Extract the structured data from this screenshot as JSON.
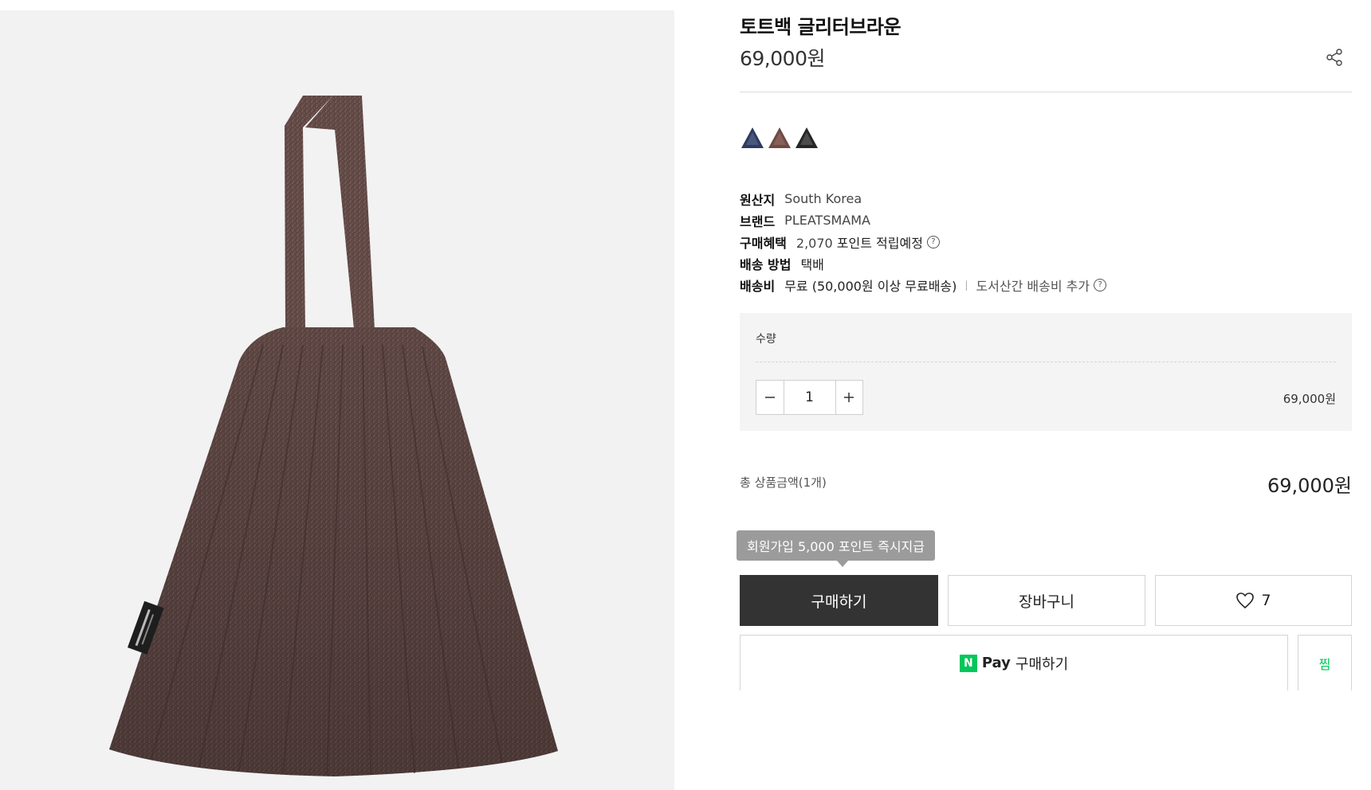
{
  "product": {
    "title": "토트백 글리터브라운",
    "price": "69,000원",
    "image_alt": "PLEATSMAMA"
  },
  "swatches": [
    {
      "name": "글리터블루",
      "color": "#2e3a5c"
    },
    {
      "name": "글리터브라운",
      "color": "#6e4a44"
    },
    {
      "name": "글리터블랙",
      "color": "#2a2a2a"
    }
  ],
  "specs": {
    "origin": {
      "key": "원산지",
      "value": "South Korea"
    },
    "brand": {
      "key": "브랜드",
      "value": "PLEATSMAMA"
    },
    "benefit": {
      "key": "구매혜택",
      "value_num": "2,070",
      "value_text": "포인트 적립예정"
    },
    "delivery_method": {
      "key": "배송 방법",
      "value": "택배"
    },
    "shipping_fee": {
      "key": "배송비",
      "value": "무료 (50,000원 이상 무료배송)",
      "extra": "도서산간 배송비 추가"
    }
  },
  "quantity": {
    "label": "수량",
    "value": "1",
    "line_price": "69,000원"
  },
  "total": {
    "label": "총 상품금액(1개)",
    "price": "69,000원"
  },
  "tooltip": "회원가입 5,000 포인트 즉시지급",
  "buttons": {
    "buy": "구매하기",
    "cart": "장바구니",
    "wish_count": "7",
    "npay_n": "N",
    "npay_pay": "Pay",
    "npay_buy": "구매하기",
    "zzim": "찜"
  },
  "colors": {
    "buy_button": "#333333",
    "naver_green": "#03c75a",
    "tooltip": "#9b9b9b"
  },
  "icons": {
    "share": "share-icon",
    "help": "question-circle-icon",
    "heart": "heart-icon",
    "minus": "minus-icon",
    "plus": "plus-icon"
  }
}
